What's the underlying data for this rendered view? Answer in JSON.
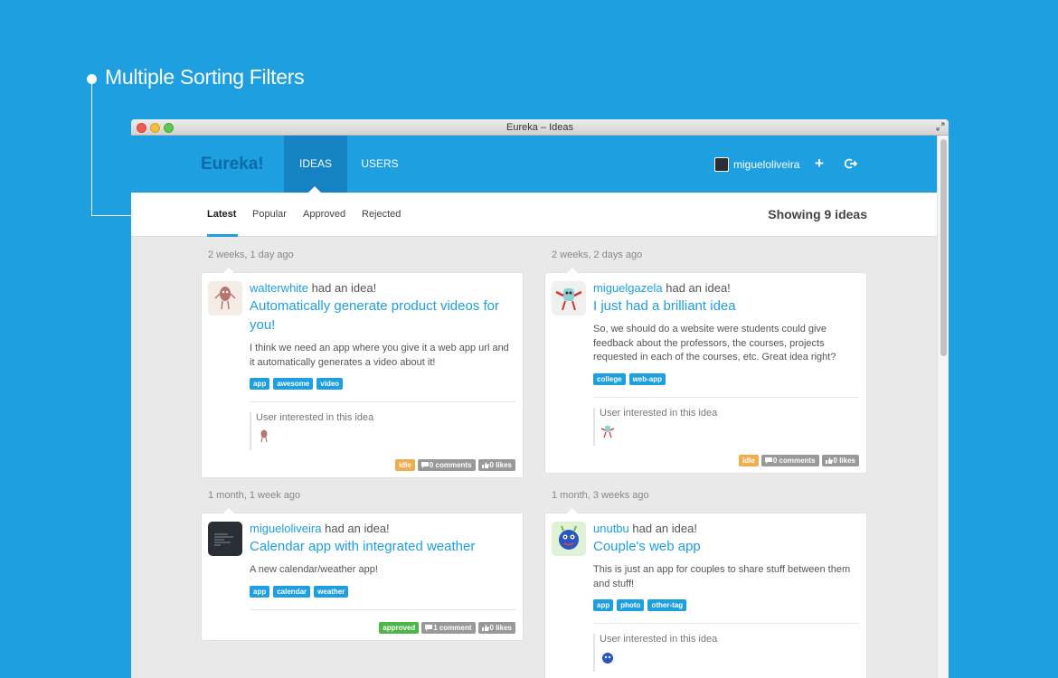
{
  "annotation": {
    "title": "Multiple Sorting Filters"
  },
  "window": {
    "title": "Eureka – Ideas"
  },
  "navbar": {
    "brand": "Eureka!",
    "tabs": [
      "IDEAS",
      "USERS"
    ],
    "username": "migueloliveira",
    "plus_icon": "+"
  },
  "sortbar": {
    "filters": [
      "Latest",
      "Popular",
      "Approved",
      "Rejected"
    ],
    "count_text": "Showing 9 ideas"
  },
  "cards": [
    {
      "timestamp": "2 weeks, 1 day ago",
      "author": "walterwhite",
      "had_idea": "had an idea!",
      "title": "Automatically generate product videos for you!",
      "description": "I think we need an app where you give it a web app url and it automatically generates a video about it!",
      "tags": [
        "app",
        "awesome",
        "video"
      ],
      "interested_label": "User interested in this idea",
      "status": "idle",
      "comments": "0 comments",
      "likes": "0 likes"
    },
    {
      "timestamp": "2 weeks, 2 days ago",
      "author": "miguelgazela",
      "had_idea": "had an idea!",
      "title": "I just had a brilliant idea",
      "description": "So, we should do a website were students could give feedback about the professors, the courses, projects requested in each of the courses, etc. Great idea right?",
      "tags": [
        "college",
        "web-app"
      ],
      "interested_label": "User interested in this idea",
      "status": "idle",
      "comments": "0 comments",
      "likes": "0 likes"
    },
    {
      "timestamp": "1 month, 1 week ago",
      "author": "migueloliveira",
      "had_idea": "had an idea!",
      "title": "Calendar app with integrated weather",
      "description": "A new calendar/weather app!",
      "tags": [
        "app",
        "calendar",
        "weather"
      ],
      "status": "approved",
      "comments": "1 comment",
      "likes": "0 likes"
    },
    {
      "timestamp": "1 month, 3 weeks ago",
      "author": "unutbu",
      "had_idea": "had an idea!",
      "title": "Couple's web app",
      "description": "This is just an app for couples to share stuff between them and stuff!",
      "tags": [
        "app",
        "photo",
        "other-tag"
      ],
      "interested_label": "User interested in this idea"
    }
  ],
  "colors": {
    "accent": "#1e9fe0",
    "nav_active": "#1482c3",
    "idle": "#f0ad4e",
    "approved": "#4bb749"
  }
}
